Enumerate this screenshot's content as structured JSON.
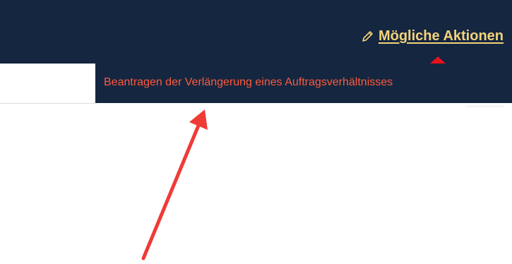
{
  "header": {
    "actions_label": "Mögliche Aktionen",
    "actions_icon": "pencil-icon"
  },
  "dropdown": {
    "items": [
      {
        "label": "Beantragen der Verlängerung eines Auftragsverhältnisses"
      }
    ]
  },
  "colors": {
    "header_bg": "#142640",
    "link": "#f5d27a",
    "menu_text": "#ff5a3c",
    "caret": "#e8111b",
    "annotation_arrow": "#ef3b36"
  }
}
